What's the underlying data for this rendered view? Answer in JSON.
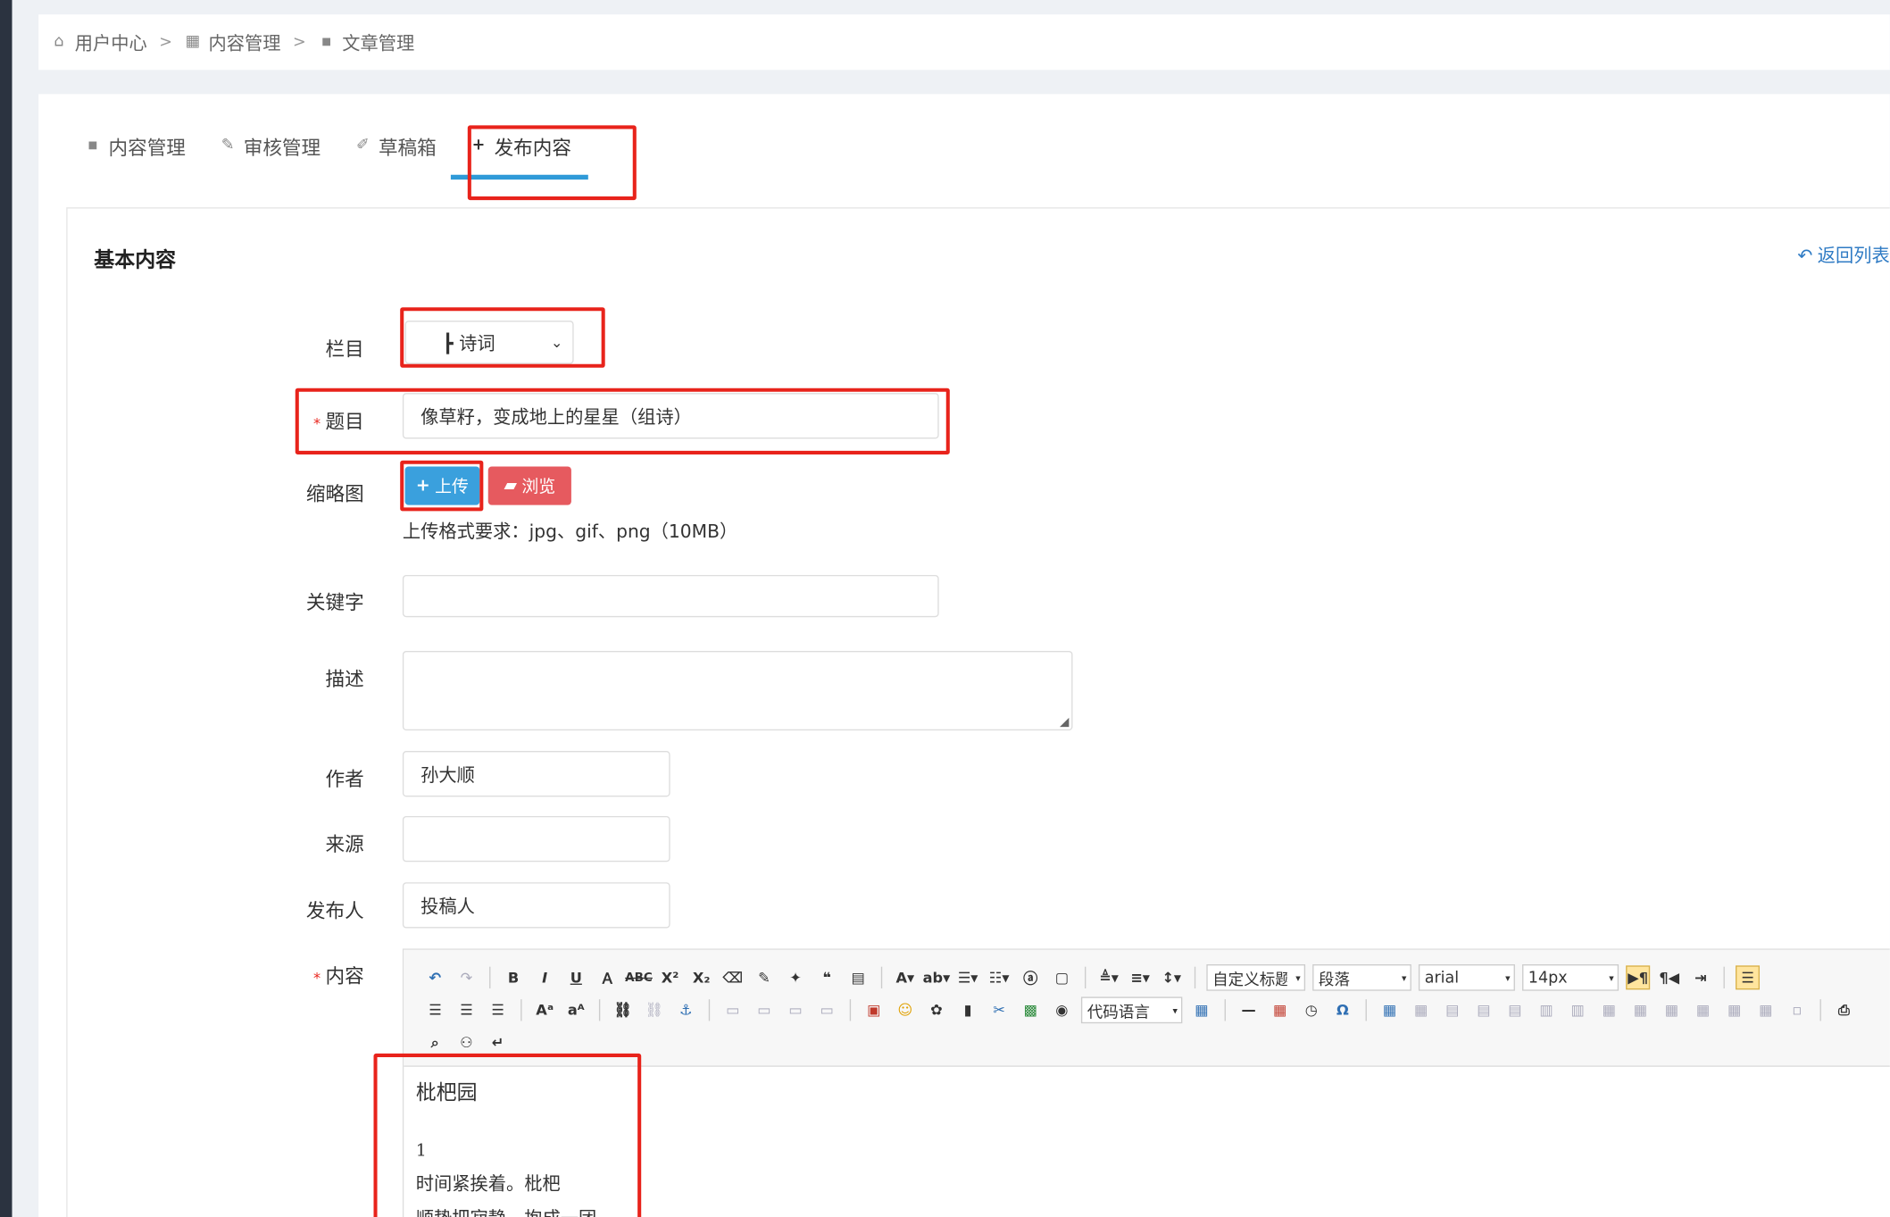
{
  "breadcrumb": [
    {
      "label": "用户中心",
      "icon": "home-icon"
    },
    {
      "label": "内容管理",
      "icon": "grid-icon"
    },
    {
      "label": "文章管理",
      "icon": "file-icon"
    }
  ],
  "tabs": [
    {
      "label": "内容管理",
      "icon": "file-icon"
    },
    {
      "label": "审核管理",
      "icon": "edit-icon"
    },
    {
      "label": "草稿箱",
      "icon": "pencil-icon"
    },
    {
      "label": "发布内容",
      "icon": "plus-icon",
      "active": true
    }
  ],
  "panel": {
    "title": "基本内容",
    "back_label": "返回列表"
  },
  "form": {
    "column": {
      "label": "栏目",
      "value": "┣ 诗词"
    },
    "title": {
      "label": "题目",
      "value": "像草籽，变成地上的星星（组诗）"
    },
    "thumbnail": {
      "label": "缩略图",
      "upload_label": "上传",
      "browse_label": "浏览",
      "hint": "上传格式要求：jpg、gif、png（10MB）"
    },
    "keywords": {
      "label": "关键字",
      "value": ""
    },
    "description": {
      "label": "描述",
      "value": ""
    },
    "author": {
      "label": "作者",
      "value": "孙大顺"
    },
    "source": {
      "label": "来源",
      "value": ""
    },
    "publisher": {
      "label": "发布人",
      "value": "投稿人"
    },
    "content": {
      "label": "内容"
    }
  },
  "editor": {
    "custom_heading": "自定义标题",
    "paragraph": "段落",
    "font": "arial",
    "size": "14px",
    "code_lang": "代码语言",
    "body": {
      "heading": "枇杷园",
      "line1": "1",
      "line2": "时间紧挨着。枇杷",
      "line3": "顺势把寂静，抱成一团"
    }
  },
  "colors": {
    "accent": "#2f9ad8",
    "upload": "#3aa0dd",
    "browse": "#e65a5f",
    "highlight": "#e8231b"
  }
}
